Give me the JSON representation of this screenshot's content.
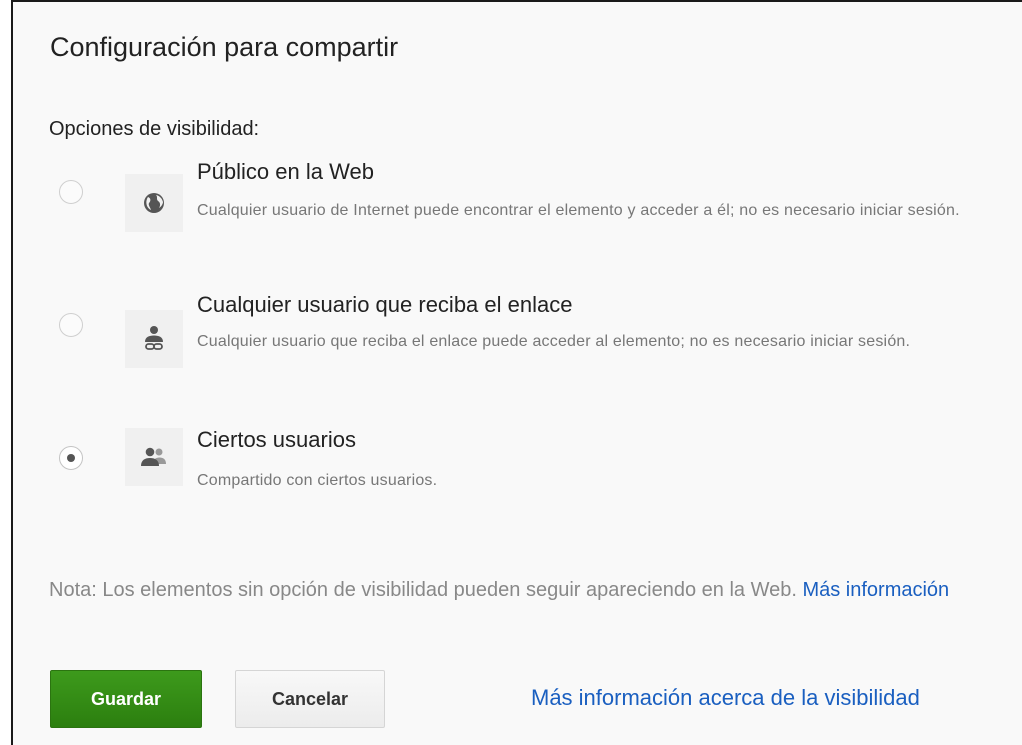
{
  "dialog": {
    "title": "Configuración para compartir",
    "section_label": "Opciones de visibilidad:"
  },
  "options": [
    {
      "title": "Público en la Web",
      "description": "Cualquier usuario de Internet puede encontrar el elemento y acceder a él; no es necesario iniciar sesión.",
      "icon": "globe-icon",
      "selected": false
    },
    {
      "title": "Cualquier usuario que reciba el enlace",
      "description": "Cualquier usuario que reciba el enlace puede acceder al elemento; no es necesario iniciar sesión.",
      "icon": "link-user-icon",
      "selected": false
    },
    {
      "title": "Ciertos usuarios",
      "description": "Compartido con ciertos usuarios.",
      "icon": "users-icon",
      "selected": true
    }
  ],
  "note": {
    "text": "Nota: Los elementos sin opción de visibilidad pueden seguir apareciendo en la Web.",
    "link": "Más información"
  },
  "buttons": {
    "save": "Guardar",
    "cancel": "Cancelar"
  },
  "footer_link": "Más información acerca de la visibilidad",
  "colors": {
    "accent_link": "#1a5fc0",
    "save_button": "#2c7f0f"
  }
}
